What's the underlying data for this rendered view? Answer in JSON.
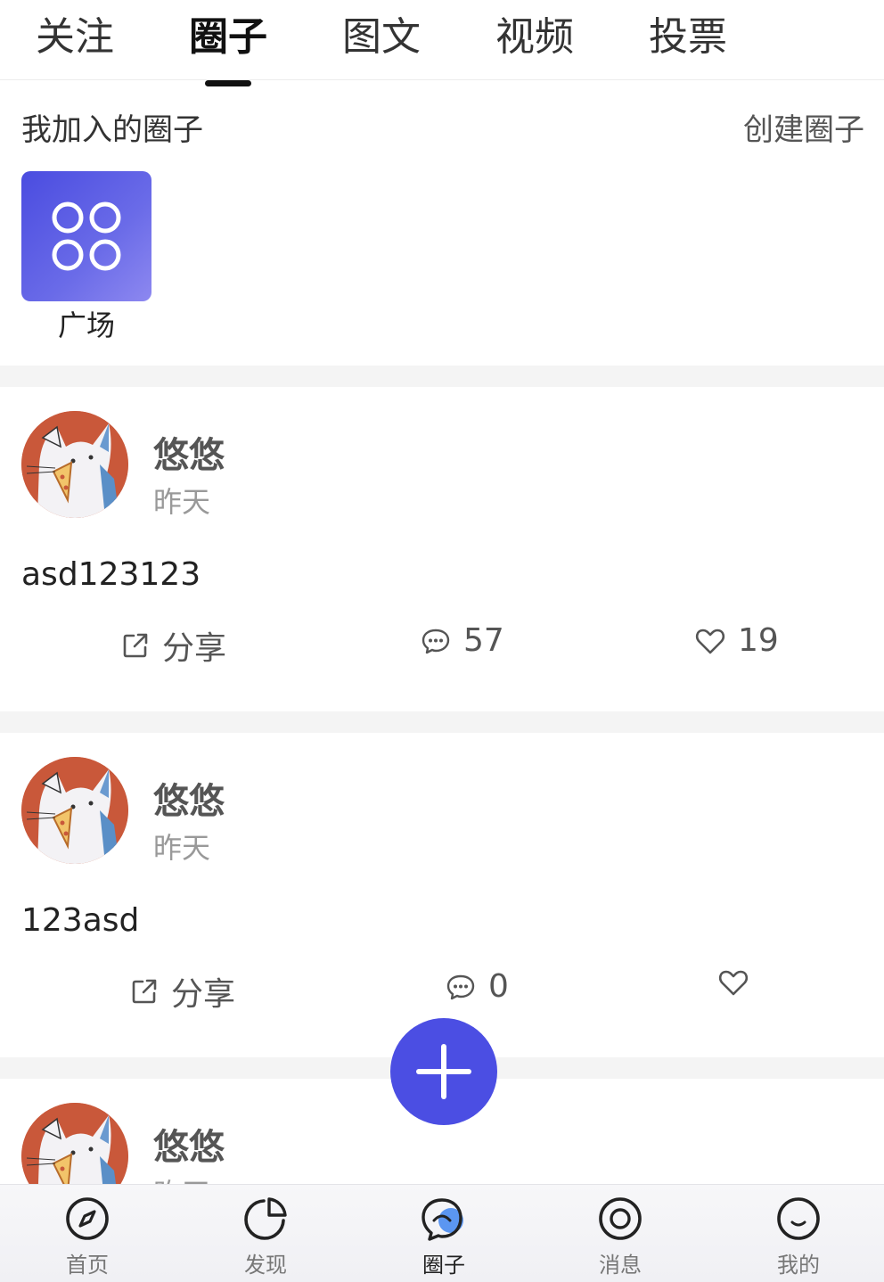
{
  "tabs": [
    {
      "label": "关注"
    },
    {
      "label": "圈子",
      "active": true
    },
    {
      "label": "图文"
    },
    {
      "label": "视频"
    },
    {
      "label": "投票"
    }
  ],
  "joined": {
    "title": "我加入的圈子",
    "create_label": "创建圈子",
    "circles": [
      {
        "label": "广场",
        "icon": "grid-icon"
      }
    ]
  },
  "posts": [
    {
      "author": "悠悠",
      "time": "昨天",
      "content": "asd123123",
      "share_label": "分享",
      "comments": "57",
      "likes": "19"
    },
    {
      "author": "悠悠",
      "time": "昨天",
      "content": "123asd",
      "share_label": "分享",
      "comments": "0",
      "likes": ""
    },
    {
      "author": "悠悠",
      "time": "昨天"
    }
  ],
  "fab": {
    "icon": "plus-icon"
  },
  "bottom_nav": [
    {
      "label": "首页",
      "icon": "compass-icon"
    },
    {
      "label": "发现",
      "icon": "pie-chart-icon"
    },
    {
      "label": "圈子",
      "icon": "chat-bubble-icon",
      "active": true
    },
    {
      "label": "消息",
      "icon": "target-icon"
    },
    {
      "label": "我的",
      "icon": "smile-icon"
    }
  ],
  "colors": {
    "accent": "#4b4ee3",
    "separator": "#f4f4f4",
    "avatar_bg": "#c9583a"
  }
}
